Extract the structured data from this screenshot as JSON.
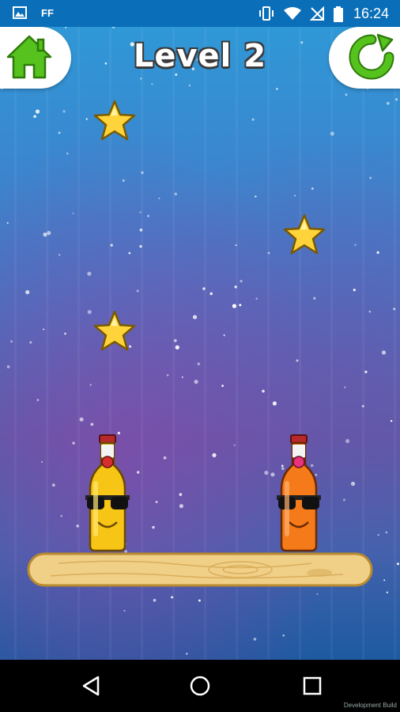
{
  "status_bar": {
    "time": "16:24",
    "carrier_label": "FF"
  },
  "header": {
    "level_title": "Level 2"
  },
  "icons": {
    "home": "home-icon",
    "restart": "restart-icon",
    "star": "star-icon",
    "back": "back-icon",
    "home_nav": "home-nav-icon",
    "recents": "recents-icon"
  },
  "colors": {
    "home_green": "#55c21e",
    "star_yellow": "#ffd43b",
    "bottle_yellow": "#f7c515",
    "bottle_orange": "#f47a1a",
    "plank": "#f0cf86"
  },
  "game": {
    "stars_count": 3,
    "bottles": [
      {
        "name": "yellow",
        "color": "#f7c515"
      },
      {
        "name": "orange",
        "color": "#f47a1a"
      }
    ]
  },
  "footer": {
    "dev_build_label": "Development Build"
  }
}
